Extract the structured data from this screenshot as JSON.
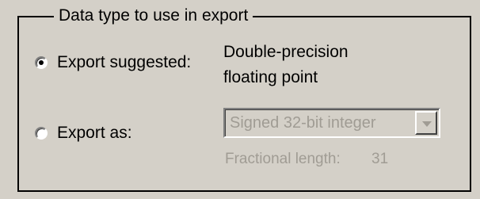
{
  "group": {
    "title": "Data type to use in export"
  },
  "options": [
    {
      "label": "Export suggested:",
      "checked": true
    },
    {
      "label": "Export as:",
      "checked": false
    }
  ],
  "suggested": {
    "line1": "Double-precision",
    "line2": "floating point"
  },
  "export_as": {
    "selected": "Signed 32-bit integer",
    "enabled": false,
    "arrow_icon": "chevron-down-icon"
  },
  "fractional": {
    "label": "Fractional length:",
    "value": "31",
    "enabled": false
  },
  "colors": {
    "background": "#d4d0c8",
    "disabled_text": "#a09c94"
  }
}
